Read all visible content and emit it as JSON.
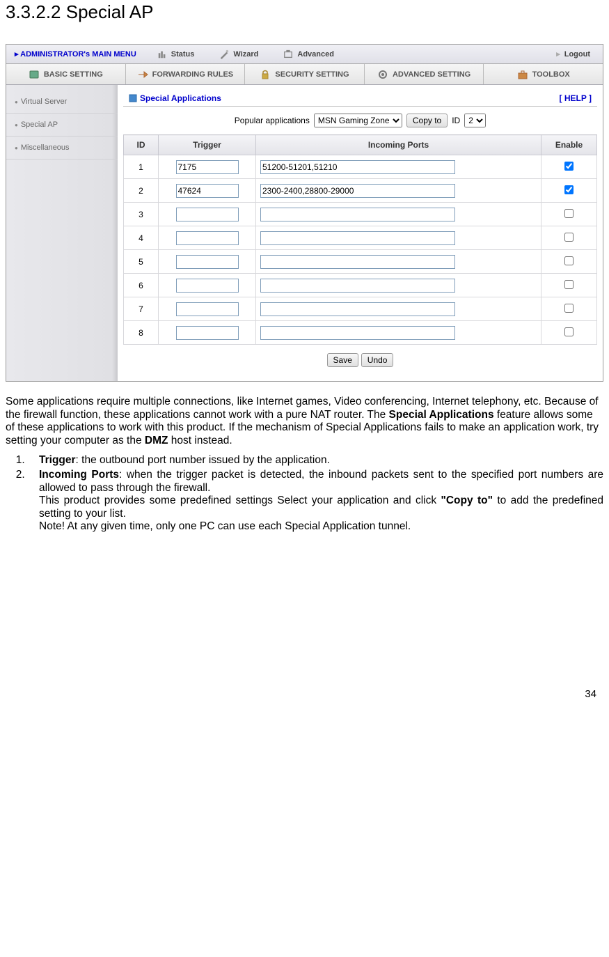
{
  "heading": "3.3.2.2 Special AP",
  "top_menu": {
    "title": "ADMINISTRATOR's MAIN MENU",
    "items": [
      "Status",
      "Wizard",
      "Advanced"
    ],
    "logout": "Logout"
  },
  "tabs": [
    "BASIC SETTING",
    "FORWARDING RULES",
    "SECURITY SETTING",
    "ADVANCED SETTING",
    "TOOLBOX"
  ],
  "sidebar": [
    "Virtual Server",
    "Special AP",
    "Miscellaneous"
  ],
  "panel": {
    "title": "Special Applications",
    "help": "[ HELP ]",
    "popular_label": "Popular applications",
    "popular_selected": "MSN Gaming Zone",
    "copy_to": "Copy to",
    "id_label": "ID",
    "id_selected": "2",
    "headers": {
      "id": "ID",
      "trigger": "Trigger",
      "incoming": "Incoming Ports",
      "enable": "Enable"
    },
    "rows": [
      {
        "id": "1",
        "trigger": "7175",
        "incoming": "51200-51201,51210",
        "enable": true
      },
      {
        "id": "2",
        "trigger": "47624",
        "incoming": "2300-2400,28800-29000",
        "enable": true
      },
      {
        "id": "3",
        "trigger": "",
        "incoming": "",
        "enable": false
      },
      {
        "id": "4",
        "trigger": "",
        "incoming": "",
        "enable": false
      },
      {
        "id": "5",
        "trigger": "",
        "incoming": "",
        "enable": false
      },
      {
        "id": "6",
        "trigger": "",
        "incoming": "",
        "enable": false
      },
      {
        "id": "7",
        "trigger": "",
        "incoming": "",
        "enable": false
      },
      {
        "id": "8",
        "trigger": "",
        "incoming": "",
        "enable": false
      }
    ],
    "save": "Save",
    "undo": "Undo"
  },
  "paragraph": {
    "pre": "Some applications require multiple connections, like Internet games, Video conferencing, Internet telephony, etc. Because of the firewall function, these applications cannot work with a pure NAT router. The ",
    "b1": "Special Applications",
    "mid": " feature allows some of these applications to work with this product. If the mechanism of Special Applications fails to make an application work, try setting your computer as the ",
    "b2": "DMZ",
    "post": " host instead."
  },
  "list": {
    "li1_b": "Trigger",
    "li1_rest": ": the outbound port number issued by the application.",
    "li2_b": "Incoming Ports",
    "li2_rest": ": when the trigger packet is detected, the inbound packets sent to the specified port numbers are allowed to pass through the firewall.",
    "li2_p2_pre": "This product provides some predefined settings Select your application and click ",
    "li2_p2_b": "\"Copy to\"",
    "li2_p2_post": " to add the predefined setting to your list.",
    "li2_p3": "Note! At any given time, only one PC can use each Special Application tunnel."
  },
  "page_number": "34"
}
